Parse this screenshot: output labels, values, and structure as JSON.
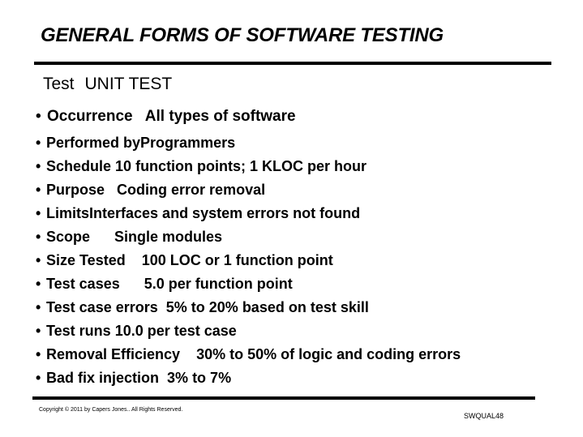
{
  "slide": {
    "title": "GENERAL FORMS OF SOFTWARE TESTING",
    "test_label": "Test",
    "test_name": "UNIT TEST",
    "bullet_glyph": "•",
    "bullets": [
      {
        "label": "Occurrence",
        "gap": "   ",
        "value": "All types of software"
      },
      {
        "label": "Performed by",
        "gap": "",
        "value": "Programmers"
      },
      {
        "label": "Schedule",
        "gap": " ",
        "value": "10 function points; 1 KLOC per hour"
      },
      {
        "label": "Purpose",
        "gap": "   ",
        "value": "Coding error removal"
      },
      {
        "label": "Limits",
        "gap": "",
        "value": "Interfaces and system errors not found"
      },
      {
        "label": "Scope",
        "gap": "      ",
        "value": "Single modules"
      },
      {
        "label": "Size Tested",
        "gap": "    ",
        "value": "100 LOC or 1 function point"
      },
      {
        "label": "Test cases",
        "gap": "      ",
        "value": "5.0 per function point"
      },
      {
        "label": "Test case errors",
        "gap": "  ",
        "value": "5% to 20% based on test skill"
      },
      {
        "label": "Test runs",
        "gap": " ",
        "value": "10.0 per test case"
      },
      {
        "label": "Removal Efficiency",
        "gap": "    ",
        "value": "30% to 50% of logic and coding errors"
      },
      {
        "label": "Bad fix injection",
        "gap": "  ",
        "value": "3% to 7%"
      }
    ],
    "footer": {
      "copyright": "Copyright © 2011 by Capers Jones.. All Rights Reserved.",
      "slide_id": "SWQUAL48"
    }
  }
}
